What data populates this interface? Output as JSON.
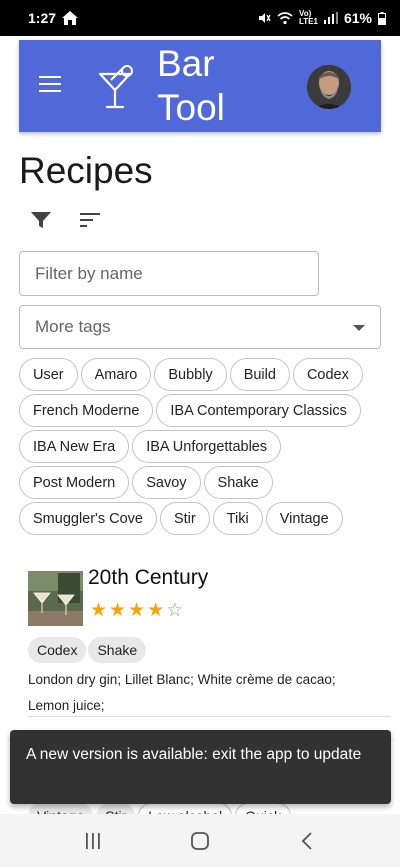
{
  "status_bar": {
    "time": "1:27",
    "battery": "61%"
  },
  "app": {
    "title_line1": "Bar",
    "title_line2": "Tool"
  },
  "page": {
    "title": "Recipes"
  },
  "filter": {
    "placeholder": "Filter by name",
    "tags_placeholder": "More tags"
  },
  "tags": [
    "User",
    "Amaro",
    "Bubbly",
    "Build",
    "Codex",
    "French Moderne",
    "IBA Contemporary Classics",
    "IBA New Era",
    "IBA Unforgettables",
    "Post Modern",
    "Savoy",
    "Shake",
    "Smuggler's Cove",
    "Stir",
    "Tiki",
    "Vintage"
  ],
  "recipe": {
    "name": "20th Century",
    "rating": 4,
    "rating_max": 5,
    "tags": [
      "Codex",
      "Shake"
    ],
    "ingredients": "London dry gin; Lillet Blanc; White crème de cacao; Lemon juice;"
  },
  "next_recipe_tags": [
    "Vintage",
    "Stir",
    "Low alcohol",
    "Quick"
  ],
  "snackbar": {
    "message": "A new version is available: exit the app to update"
  },
  "colors": {
    "appbar": "#5169d8",
    "star": "#f4a50a",
    "snackbar": "#323232"
  }
}
